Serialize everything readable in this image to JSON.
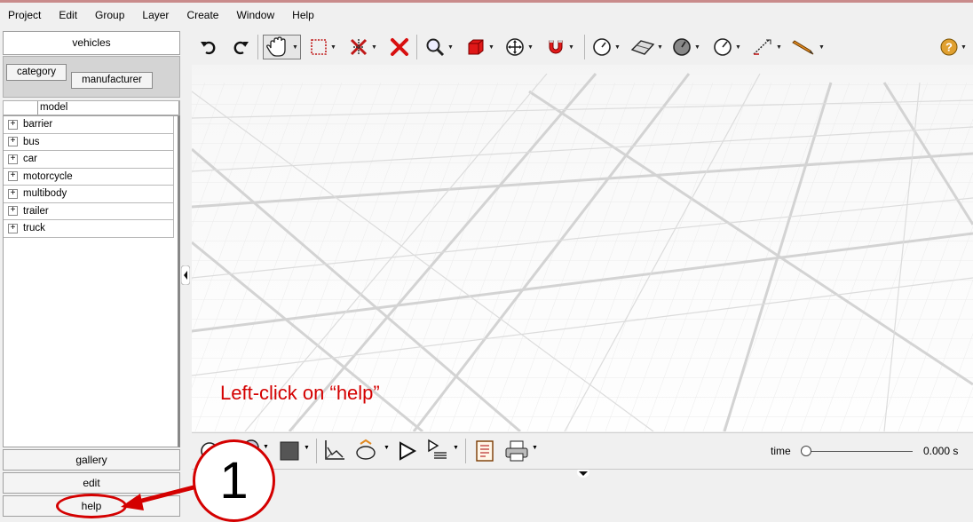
{
  "menu": [
    "Project",
    "Edit",
    "Group",
    "Layer",
    "Create",
    "Window",
    "Help"
  ],
  "left_panel": {
    "tab_label": "vehicles",
    "category_label": "category",
    "manufacturer_label": "manufacturer",
    "column_header": "model",
    "tree_items": [
      "barrier",
      "bus",
      "car",
      "motorcycle",
      "multibody",
      "trailer",
      "truck"
    ],
    "expand_glyph": "+",
    "gallery_label": "gallery",
    "edit_label": "edit",
    "help_label": "help"
  },
  "toolbar_icons": [
    "undo-icon",
    "redo-icon",
    "hand-pan-icon",
    "select-rect-icon",
    "cut-select-icon",
    "delete-x-icon",
    "zoom-icon",
    "cube-icon",
    "move-icon",
    "magnet-icon",
    "dial-1-icon",
    "surface-icon",
    "dial-2-icon",
    "dial-3-icon",
    "measure-icon",
    "pencil-icon",
    "help-icon"
  ],
  "annotation": {
    "text": "Left-click on “help”",
    "color": "#d40000"
  },
  "callout": {
    "number": "1"
  },
  "timeline": {
    "label": "time",
    "value": "0.000 s"
  }
}
